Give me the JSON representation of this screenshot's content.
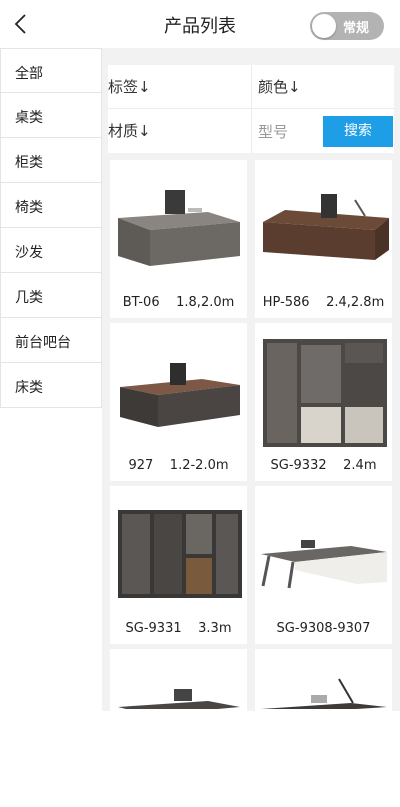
{
  "header": {
    "title": "产品列表",
    "toggle_label": "常规"
  },
  "sidebar": {
    "items": [
      {
        "label": "全部"
      },
      {
        "label": "桌类"
      },
      {
        "label": "柜类"
      },
      {
        "label": "椅类"
      },
      {
        "label": "沙发"
      },
      {
        "label": "几类"
      },
      {
        "label": "前台吧台"
      },
      {
        "label": "床类"
      }
    ]
  },
  "filter": {
    "tag_label": "标签↓",
    "color_label": "颜色↓",
    "material_label": "材质↓",
    "model_placeholder": "型号",
    "search_label": "搜索"
  },
  "products": [
    {
      "label": "BT-06    1.8,2.0m"
    },
    {
      "label": "HP-586    2.4,2.8m"
    },
    {
      "label": "927    1.2-2.0m"
    },
    {
      "label": "SG-9332    2.4m"
    },
    {
      "label": "SG-9331    3.3m"
    },
    {
      "label": "SG-9308-9307"
    },
    {
      "label": ""
    },
    {
      "label": ""
    }
  ],
  "colors": {
    "accent": "#1e9ee6",
    "toggle_bg": "#b3b3b3"
  }
}
